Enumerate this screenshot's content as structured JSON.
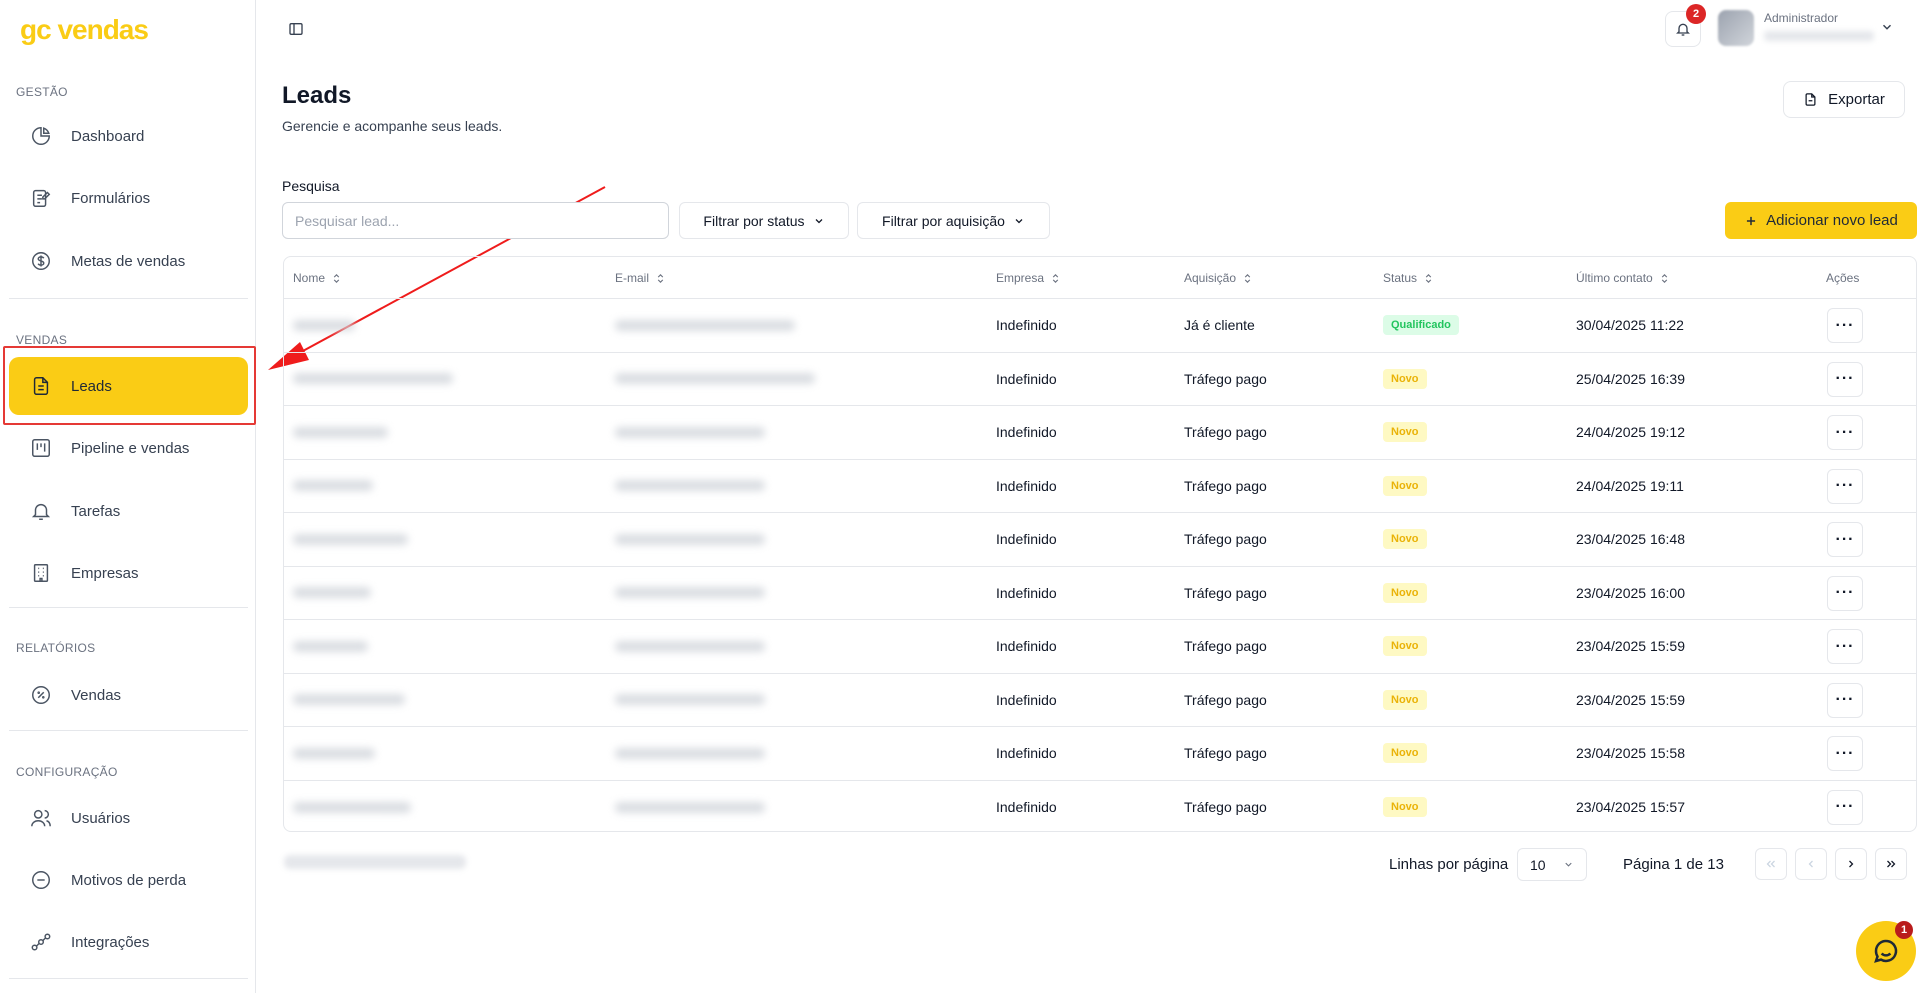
{
  "brand": {
    "logo_text": "gc vendas",
    "accent": "#facc15"
  },
  "sidebar": {
    "sections": [
      {
        "title": "GESTÃO"
      },
      {
        "title": "VENDAS"
      },
      {
        "title": "RELATÓRIOS"
      },
      {
        "title": "CONFIGURAÇÃO"
      }
    ],
    "items": [
      {
        "label": "Dashboard",
        "icon": "pie-chart-icon"
      },
      {
        "label": "Formulários",
        "icon": "form-icon"
      },
      {
        "label": "Metas de vendas",
        "icon": "dollar-circle-icon"
      },
      {
        "label": "Leads",
        "icon": "document-icon",
        "active": true
      },
      {
        "label": "Pipeline e vendas",
        "icon": "kanban-icon"
      },
      {
        "label": "Tarefas",
        "icon": "bell-icon"
      },
      {
        "label": "Empresas",
        "icon": "building-icon"
      },
      {
        "label": "Vendas",
        "icon": "percent-circle-icon"
      },
      {
        "label": "Usuários",
        "icon": "users-icon"
      },
      {
        "label": "Motivos de perda",
        "icon": "minus-circle-icon"
      },
      {
        "label": "Integrações",
        "icon": "workflow-icon"
      }
    ]
  },
  "topbar": {
    "notifications_count": "2",
    "user_role": "Administrador"
  },
  "page": {
    "title": "Leads",
    "subtitle": "Gerencie e acompanhe seus leads.",
    "export_label": "Exportar",
    "search_label": "Pesquisa",
    "search_placeholder": "Pesquisar lead...",
    "filter_status_label": "Filtrar por status",
    "filter_acquisition_label": "Filtrar por aquisição",
    "add_lead_label": "Adicionar novo lead"
  },
  "table": {
    "columns": [
      "Nome",
      "E-mail",
      "Empresa",
      "Aquisição",
      "Status",
      "Último contato",
      "Ações"
    ],
    "rows": [
      {
        "empresa": "Indefinido",
        "aquisicao": "Já é cliente",
        "status": "Qualificado",
        "status_type": "qual",
        "ultimo_contato": "30/04/2025 11:22"
      },
      {
        "empresa": "Indefinido",
        "aquisicao": "Tráfego pago",
        "status": "Novo",
        "status_type": "novo",
        "ultimo_contato": "25/04/2025 16:39"
      },
      {
        "empresa": "Indefinido",
        "aquisicao": "Tráfego pago",
        "status": "Novo",
        "status_type": "novo",
        "ultimo_contato": "24/04/2025 19:12"
      },
      {
        "empresa": "Indefinido",
        "aquisicao": "Tráfego pago",
        "status": "Novo",
        "status_type": "novo",
        "ultimo_contato": "24/04/2025 19:11"
      },
      {
        "empresa": "Indefinido",
        "aquisicao": "Tráfego pago",
        "status": "Novo",
        "status_type": "novo",
        "ultimo_contato": "23/04/2025 16:48"
      },
      {
        "empresa": "Indefinido",
        "aquisicao": "Tráfego pago",
        "status": "Novo",
        "status_type": "novo",
        "ultimo_contato": "23/04/2025 16:00"
      },
      {
        "empresa": "Indefinido",
        "aquisicao": "Tráfego pago",
        "status": "Novo",
        "status_type": "novo",
        "ultimo_contato": "23/04/2025 15:59"
      },
      {
        "empresa": "Indefinido",
        "aquisicao": "Tráfego pago",
        "status": "Novo",
        "status_type": "novo",
        "ultimo_contato": "23/04/2025 15:59"
      },
      {
        "empresa": "Indefinido",
        "aquisicao": "Tráfego pago",
        "status": "Novo",
        "status_type": "novo",
        "ultimo_contato": "23/04/2025 15:58"
      },
      {
        "empresa": "Indefinido",
        "aquisicao": "Tráfego pago",
        "status": "Novo",
        "status_type": "novo",
        "ultimo_contato": "23/04/2025 15:57"
      }
    ],
    "action_label": "···"
  },
  "pagination": {
    "rows_per_page_label": "Linhas por página",
    "rows_per_page_value": "10",
    "page_info": "Página 1 de 13"
  },
  "chat": {
    "unread_count": "1"
  }
}
